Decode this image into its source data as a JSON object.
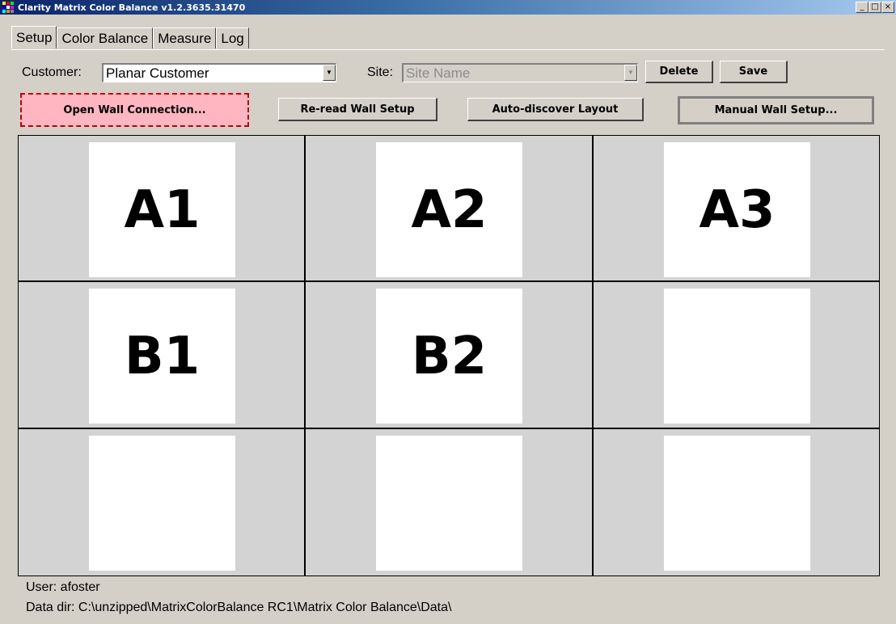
{
  "window": {
    "title": "Clarity Matrix Color Balance v1.2.3635.31470",
    "minimize_glyph": "_",
    "maximize_glyph": "□",
    "close_glyph": "×",
    "icon": "app-grid-icon"
  },
  "tabs": [
    {
      "label": "Setup",
      "active": true
    },
    {
      "label": "Color Balance",
      "active": false
    },
    {
      "label": "Measure",
      "active": false
    },
    {
      "label": "Log",
      "active": false
    }
  ],
  "customer": {
    "label": "Customer:",
    "value": "Planar Customer"
  },
  "site": {
    "label": "Site:",
    "value": "Site Name",
    "disabled": true
  },
  "buttons": {
    "delete": "Delete",
    "save": "Save",
    "open_wall": "Open Wall Connection...",
    "reread": "Re-read Wall Setup",
    "autodiscover": "Auto-discover Layout",
    "manual": "Manual Wall Setup..."
  },
  "grid": {
    "rows": 3,
    "cols": 3,
    "cells": [
      [
        "A1",
        "A2",
        "A3"
      ],
      [
        "B1",
        "B2",
        ""
      ],
      [
        "",
        "",
        ""
      ]
    ]
  },
  "status": {
    "user": "User: afoster",
    "data_dir": "Data dir: C:\\unzipped\\MatrixColorBalance RC1\\Matrix Color Balance\\Data\\"
  },
  "colors": {
    "window_bg": "#d4d0c8",
    "title_start": "#0a246a",
    "title_end": "#a6caf0",
    "open_wall_bg": "#ffb6c1",
    "open_wall_border": "#c00000",
    "cell_bg": "#d3d3d3",
    "panel_bg": "#ffffff"
  }
}
